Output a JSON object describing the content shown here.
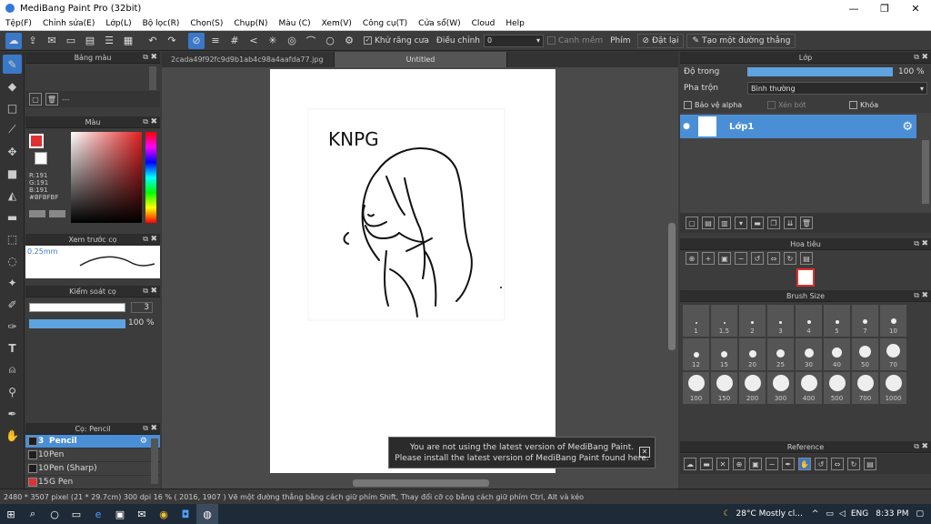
{
  "window": {
    "title": "MediBang Paint Pro (32bit)",
    "min": "—",
    "max": "❐",
    "close": "✕"
  },
  "menu": [
    "Tệp(F)",
    "Chỉnh sửa(E)",
    "Lớp(L)",
    "Bộ lọc(R)",
    "Chọn(S)",
    "Chụp(N)",
    "Màu (C)",
    "Xem(V)",
    "Công cụ(T)",
    "Cửa sổ(W)",
    "Cloud",
    "Help"
  ],
  "toolbar": {
    "antialias_label": "Khử răng cưa",
    "correction_label": "Điều chỉnh",
    "correction_value": "0",
    "smooth_label": "Canh mềm",
    "key_label": "Phím",
    "reset_label": "Đặt lại",
    "line_label": "Tạo một đường thẳng"
  },
  "left": {
    "palette_title": "Bảng màu",
    "palette_text": "---",
    "color_title": "Màu",
    "rgb_r": "R:191",
    "rgb_g": "G:191",
    "rgb_b": "B:191",
    "hex": "#BFBFBF",
    "preview_title": "Xem trước cọ",
    "preview_size": "0.25mm",
    "brush_control_title": "Kiểm soát cọ",
    "brush_size_value": "3",
    "opacity_value": "100 %",
    "brush_list_title": "Cọ: Pencil",
    "brushes": [
      {
        "size": "3",
        "name": "Pencil",
        "color": "#1e1e1e"
      },
      {
        "size": "10",
        "name": "Pen",
        "color": "#1e1e1e"
      },
      {
        "size": "10",
        "name": "Pen (Sharp)",
        "color": "#1e1e1e"
      },
      {
        "size": "15",
        "name": "G Pen",
        "color": "#e03030"
      }
    ]
  },
  "canvas": {
    "tabs": [
      "2cada49f92fc9d9b1ab4c98a4aafda77.jpg",
      "Untitled"
    ],
    "drawing_text": "KNPG",
    "notice_line1": "You are not using the latest version of MediBang Paint.",
    "notice_line2": "Please install the latest version of MediBang Paint found here.",
    "notice_close": "✕"
  },
  "right": {
    "layer_title": "Lớp",
    "opacity_label": "Độ trong",
    "opacity_value": "100 %",
    "blend_label": "Pha trộn",
    "blend_value": "Bình thường",
    "protect_alpha": "Bảo vệ alpha",
    "clipping": "Xén bớt",
    "lock": "Khóa",
    "layer_name": "Lớp1",
    "navigator_title": "Hoa tiêu",
    "brushsize_title": "Brush Size",
    "brush_sizes": [
      "1",
      "1.5",
      "2",
      "3",
      "4",
      "5",
      "7",
      "10",
      "12",
      "15",
      "20",
      "25",
      "30",
      "40",
      "50",
      "70",
      "100",
      "150",
      "200",
      "300",
      "400",
      "500",
      "700",
      "1000"
    ],
    "reference_title": "Reference"
  },
  "status": {
    "text": "2480 * 3507 pixel  (21 * 29.7cm)  300 dpi  16 %  ( 2016, 1907 )  Vẽ một đường thẳng bằng cách giữ phím Shift, Thay đổi cỡ cọ bằng cách giữ phím Ctrl, Alt và kéo"
  },
  "taskbar": {
    "weather": "28°C  Mostly cl...",
    "lang": "ENG",
    "time": "8:33 PM"
  },
  "colors": {
    "accent": "#3a78c8",
    "panel": "#3c3c3c",
    "layer_selected": "#4a8fd6"
  }
}
